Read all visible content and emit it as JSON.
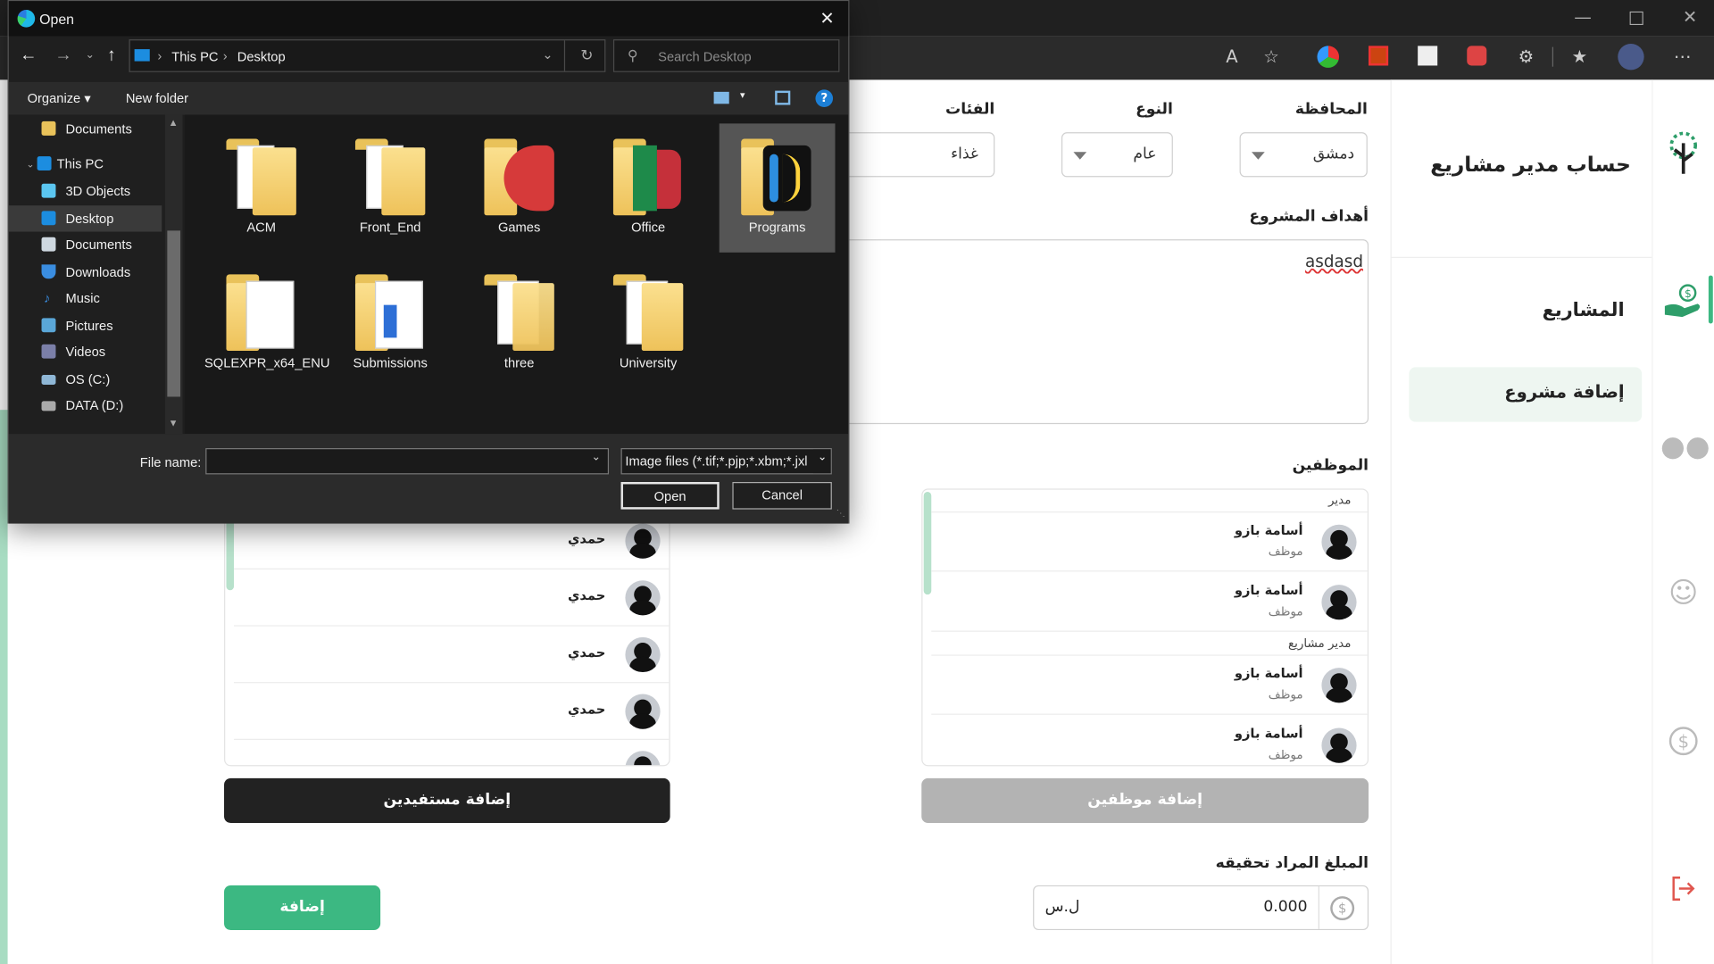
{
  "browser": {
    "tab_title": "Open",
    "window_controls": [
      "minimize",
      "maximize",
      "close"
    ]
  },
  "dialog": {
    "title": "Open",
    "breadcrumb": [
      "This PC",
      "Desktop"
    ],
    "search_placeholder": "Search Desktop",
    "toolbar": {
      "organize": "Organize",
      "new_folder": "New folder"
    },
    "nav": [
      {
        "label": "Documents",
        "icon": "documents-icon"
      },
      {
        "label": "This PC",
        "icon": "pc-icon"
      },
      {
        "label": "3D Objects",
        "icon": "cube-icon"
      },
      {
        "label": "Desktop",
        "icon": "desktop-icon"
      },
      {
        "label": "Documents",
        "icon": "documents-icon"
      },
      {
        "label": "Downloads",
        "icon": "download-icon"
      },
      {
        "label": "Music",
        "icon": "music-icon"
      },
      {
        "label": "Pictures",
        "icon": "pictures-icon"
      },
      {
        "label": "Videos",
        "icon": "videos-icon"
      },
      {
        "label": "OS (C:)",
        "icon": "drive-icon"
      },
      {
        "label": "DATA (D:)",
        "icon": "drive-icon"
      }
    ],
    "folders": [
      "ACM",
      "Front_End",
      "Games",
      "Office",
      "Programs",
      "SQLEXPR_x64_ENU",
      "Submissions",
      "three",
      "University"
    ],
    "selected_folder": "Programs",
    "file_name_label": "File name:",
    "file_name_value": "",
    "file_type": "Image files (*.tif;*.pjp;*.xbm;*.jxl",
    "open_button": "Open",
    "cancel_button": "Cancel"
  },
  "sidebar": {
    "title": "حساب مدير مشاريع",
    "section": "المشاريع",
    "active_item": "إضافة مشروع",
    "icons": [
      "logo-tree-icon",
      "hand-money-icon",
      "group-icon",
      "users-add-icon",
      "dollar-icon",
      "logout-icon"
    ]
  },
  "form": {
    "governorate_label": "المحافظة",
    "governorate_value": "دمشق",
    "type_label": "النوع",
    "type_value": "عام",
    "category_label": "الفئات",
    "category_value": "غذاء",
    "goals_label": "أهداف المشروع",
    "goals_value": "asdasd",
    "employees_label": "الموظفين",
    "employees_groups": [
      {
        "group": "مدير",
        "people": [
          {
            "name": "أسامة بازو",
            "role": "موظف"
          },
          {
            "name": "أسامة بازو",
            "role": "موظف"
          }
        ]
      },
      {
        "group": "مدير مشاريع",
        "people": [
          {
            "name": "أسامة بازو",
            "role": "موظف"
          },
          {
            "name": "أسامة بازو",
            "role": "موظف"
          }
        ]
      }
    ],
    "beneficiaries": [
      "حمدي",
      "حمدي",
      "حمدي",
      "حمدي"
    ],
    "add_beneficiaries_button": "إضافة مستفيدين",
    "add_employees_button": "إضافة موظفين",
    "amount_label": "المبلغ المراد تحقيقه",
    "amount_value": "0.000",
    "currency": "ل.س",
    "submit_button": "إضافة",
    "accent_color": "#3cb882"
  }
}
